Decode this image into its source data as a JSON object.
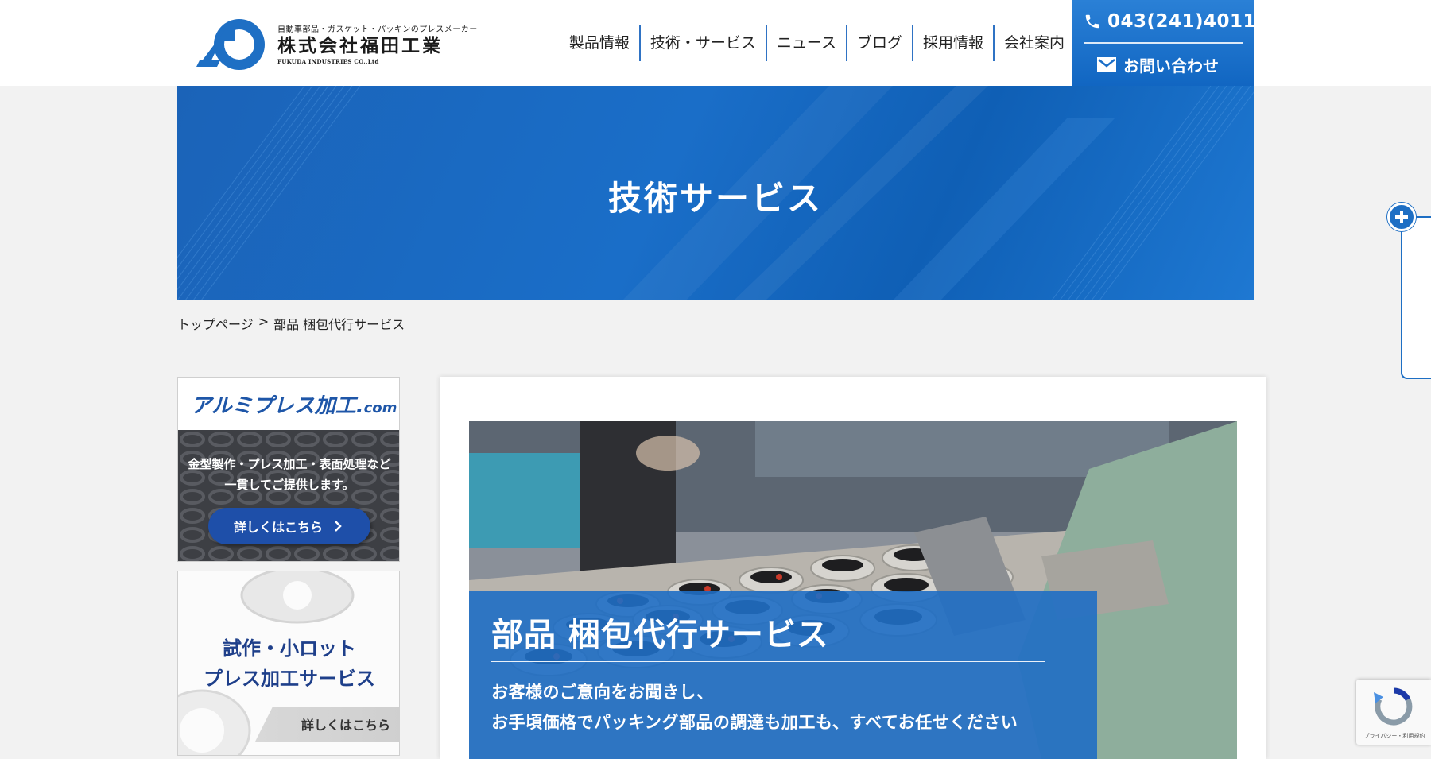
{
  "header": {
    "logo": {
      "tagline": "自動車部品・ガスケット・パッキンのプレスメーカー",
      "company_name": "株式会社福田工業",
      "company_name_en": "FUKUDA INDUSTRIES CO.,Ltd"
    },
    "nav": [
      {
        "label": "製品情報"
      },
      {
        "label": "技術・サービス"
      },
      {
        "label": "ニュース"
      },
      {
        "label": "ブログ"
      },
      {
        "label": "採用情報"
      },
      {
        "label": "会社案内"
      }
    ],
    "contact": {
      "phone": "043(241)4011",
      "mail_label": "お問い合わせ",
      "phone_icon": "phone-icon",
      "mail_icon": "mail-icon"
    }
  },
  "banner": {
    "title": "技術サービス"
  },
  "breadcrumb": {
    "home": "トップページ",
    "separator": ">",
    "current": "部品 梱包代行サービス"
  },
  "sidebar": {
    "card1": {
      "title_main": "アルミプレス加工.",
      "title_suffix": "com",
      "description_line1": "金型製作・プレス加工・表面処理など",
      "description_line2": "一貫してご提供します。",
      "button_label": "詳しくはこちら",
      "button_icon": "chevron-right-icon"
    },
    "card2": {
      "line1": "試作・小ロット",
      "line2": "プレス加工サービス",
      "button_label": "詳しくはこちら"
    }
  },
  "main": {
    "hero": {
      "title": "部品 梱包代行サービス",
      "description_line1": "お客様のご意向をお聞きし、",
      "description_line2": "お手頃価格でパッキング部品の調達も加工も、すべてお任せください"
    }
  },
  "widgets": {
    "side_toggle_icon": "plus-icon",
    "recaptcha_label": "プライバシー・利用規約"
  },
  "colors": {
    "brand_blue": "#1e6fc4",
    "nav_divider": "#2f73c4",
    "banner_blue": "#1a6ec8",
    "sidebar_button_blue": "#1e4fa9"
  }
}
